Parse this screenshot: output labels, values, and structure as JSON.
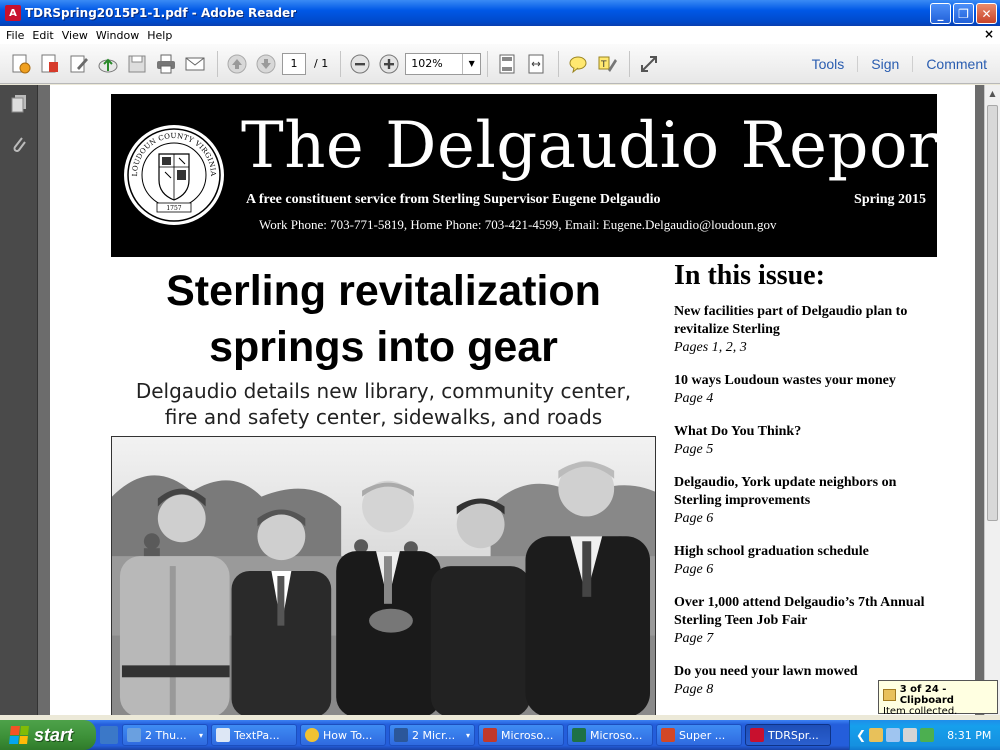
{
  "window": {
    "title": "TDRSpring2015P1-1.pdf - Adobe Reader",
    "app_icon_letter": "A",
    "minimize": "_",
    "maximize": "❐",
    "close": "✕"
  },
  "menu": {
    "items": [
      "File",
      "Edit",
      "View",
      "Window",
      "Help"
    ],
    "doc_close": "×"
  },
  "toolbar": {
    "page_current": "1",
    "page_of": "/ 1",
    "zoom": "102%",
    "panels": [
      "Tools",
      "Sign",
      "Comment"
    ]
  },
  "newsletter": {
    "title": "The Delgaudio Report",
    "tagline": "A free constituent service from Sterling Supervisor Eugene Delgaudio",
    "season": "Spring 2015",
    "contact": "Work Phone: 703-771-5819, Home Phone: 703-421-4599, Email: Eugene.Delgaudio@loudoun.gov",
    "seal_top": "LOUDOUN COUNTY VIRGINIA",
    "seal_year": "1757",
    "headline_1": "Sterling revitalization",
    "headline_2": "springs into gear",
    "subhead_1": "Delgaudio details new library, community center,",
    "subhead_2": "fire and safety center, sidewalks, and roads",
    "issue_title": "In this issue:",
    "issue_items": [
      {
        "head": "New facilities part of Delgaudio plan to revitalize Sterling",
        "page": "Pages 1, 2, 3"
      },
      {
        "head": "10 ways Loudoun wastes your money",
        "page": "Page 4"
      },
      {
        "head": "What Do You Think?",
        "page": "Page 5"
      },
      {
        "head": "Delgaudio, York update neighbors on Sterling improvements",
        "page": "Page 6"
      },
      {
        "head": "High school graduation schedule",
        "page": "Page 6"
      },
      {
        "head": "Over 1,000 attend Delgaudio’s 7th Annual Sterling Teen Job Fair",
        "page": "Page 7"
      },
      {
        "head": "Do you need your lawn mowed",
        "page": "Page 8"
      }
    ]
  },
  "clipboard": {
    "title": "3 of 24 - Clipboard",
    "message": "Item collected."
  },
  "taskbar": {
    "start": "start",
    "tasks": [
      "2 Thu...",
      "TextPa...",
      "How To...",
      "2 Micr...",
      "Microso...",
      "Microso...",
      "Super ...",
      "TDRSpr..."
    ],
    "clock": "8:31 PM"
  }
}
